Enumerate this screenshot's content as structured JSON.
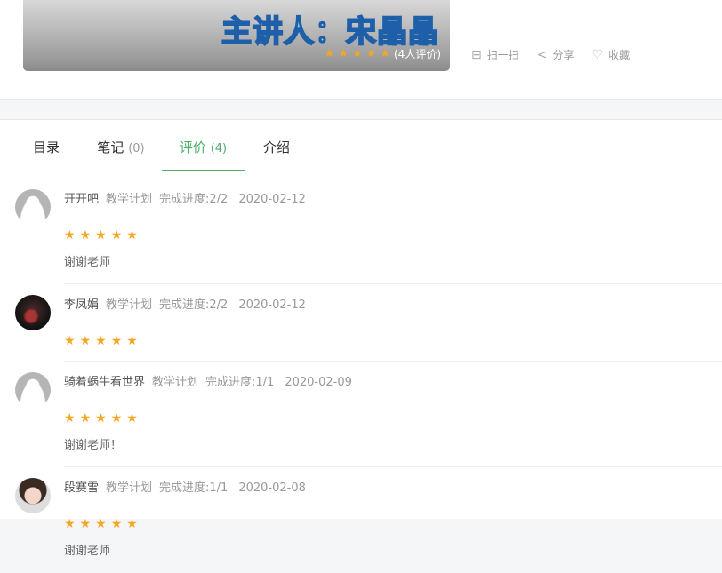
{
  "course": {
    "banner_text": "主讲人：宋晶晶",
    "rating_stars": 5,
    "rating_count_label": "(4人评价)",
    "actions": [
      {
        "icon": "qrcode-icon",
        "label": "扫一扫"
      },
      {
        "icon": "share-icon",
        "label": "分享"
      },
      {
        "icon": "heart-icon",
        "label": "收藏"
      }
    ]
  },
  "tabs": [
    {
      "label": "目录",
      "count": ""
    },
    {
      "label": "笔记",
      "count": "(0)"
    },
    {
      "label": "评价",
      "count": "(4)",
      "active": true
    },
    {
      "label": "介绍",
      "count": ""
    }
  ],
  "reviews": [
    {
      "name": "开开吧",
      "plan": "教学计划",
      "progress": "完成进度:2/2",
      "date": "2020-02-12",
      "stars": 5,
      "comment": "谢谢老师",
      "avatar": "default"
    },
    {
      "name": "李凤娟",
      "plan": "教学计划",
      "progress": "完成进度:2/2",
      "date": "2020-02-12",
      "stars": 5,
      "comment": "",
      "avatar": "photo-dark"
    },
    {
      "name": "骑着蜗牛看世界",
      "plan": "教学计划",
      "progress": "完成进度:1/1",
      "date": "2020-02-09",
      "stars": 5,
      "comment": "谢谢老师！",
      "avatar": "default"
    },
    {
      "name": "段赛雪",
      "plan": "教学计划",
      "progress": "完成进度:1/1",
      "date": "2020-02-08",
      "stars": 5,
      "comment": "谢谢老师",
      "avatar": "photo-light"
    }
  ],
  "colors": {
    "accent": "#4caf6a",
    "star": "#f5a623"
  }
}
